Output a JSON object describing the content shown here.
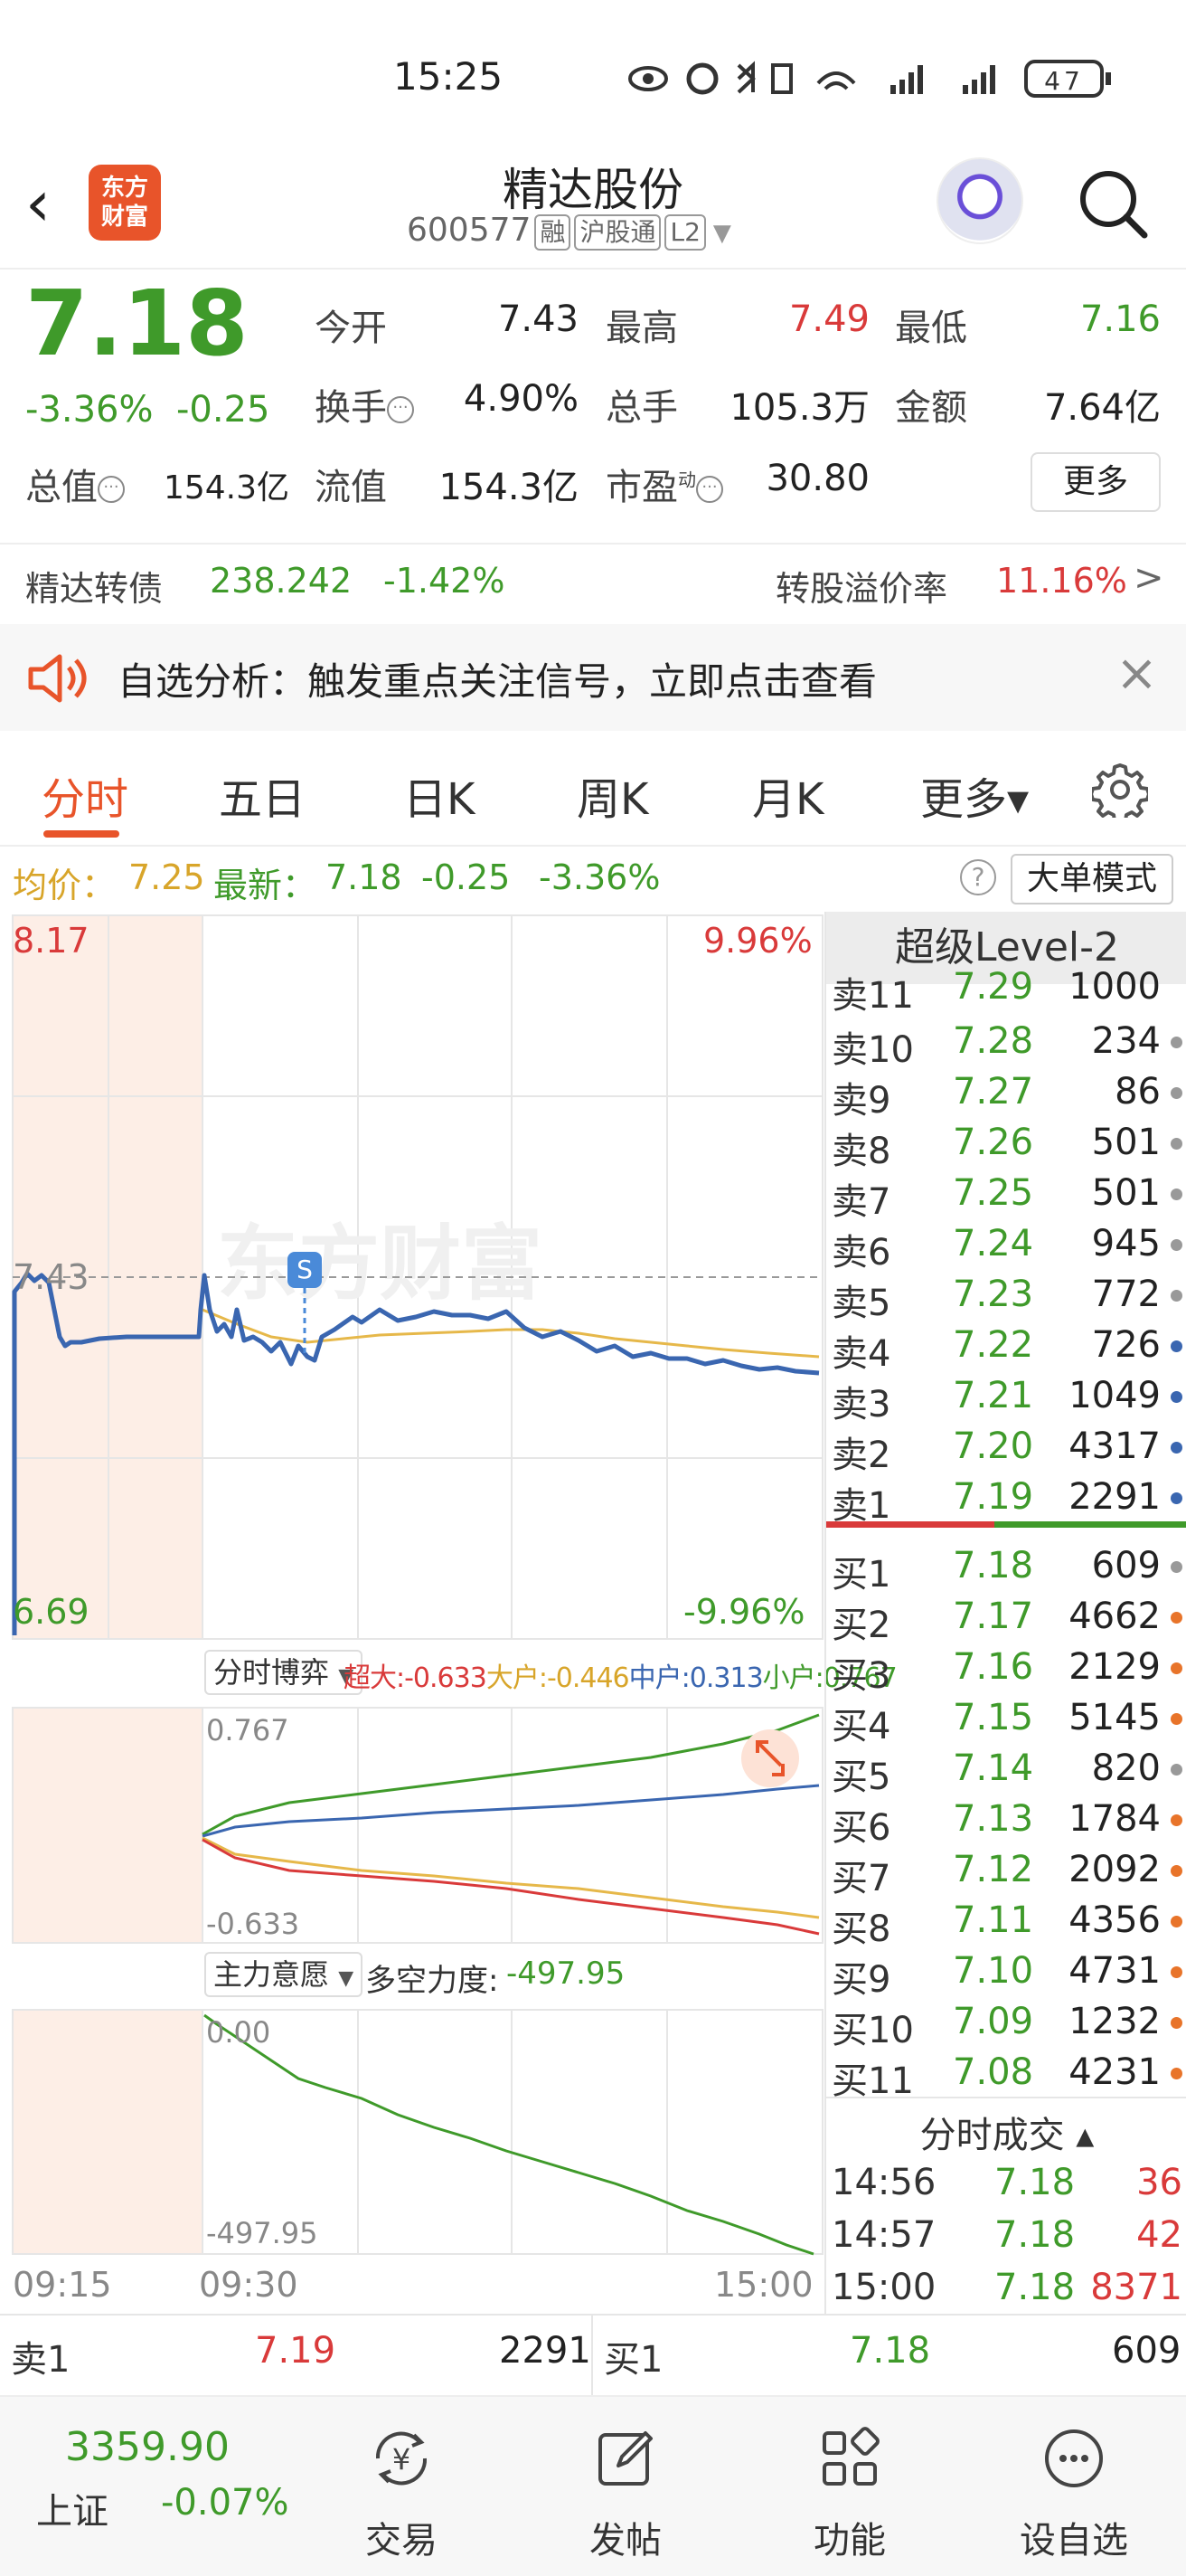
{
  "status_bar": {
    "time": "15:25",
    "battery": "47"
  },
  "header": {
    "back_glyph": "‹",
    "brand_line1": "东方",
    "brand_line2": "财富",
    "name": "精达股份",
    "code": "600577",
    "tags": [
      "融",
      "沪股通",
      "L2"
    ]
  },
  "quote": {
    "price": "7.18",
    "change_pct": "-3.36%",
    "change": "-0.25",
    "open_label": "今开",
    "open": "7.43",
    "high_label": "最高",
    "high": "7.49",
    "low_label": "最低",
    "low": "7.16",
    "turnover_rate_label": "换手",
    "turnover_rate": "4.90%",
    "volume_label": "总手",
    "volume": "105.3万",
    "amount_label": "金额",
    "amount": "7.64亿",
    "total_cap_label": "总值",
    "total_cap": "154.3亿",
    "float_cap_label": "流值",
    "float_cap": "154.3亿",
    "pe_label": "市盈",
    "pe_sup": "动",
    "pe": "30.80",
    "more_label": "更多"
  },
  "bond": {
    "name": "精达转债",
    "price": "238.242",
    "change": "-1.42%",
    "premium_label": "转股溢价率",
    "premium": "11.16%",
    "arrow": ">"
  },
  "alert": {
    "text": "自选分析：触发重点关注信号，立即点击查看",
    "close": "×"
  },
  "tabs": [
    {
      "label": "分时"
    },
    {
      "label": "五日"
    },
    {
      "label": "日K"
    },
    {
      "label": "周K"
    },
    {
      "label": "月K"
    },
    {
      "label": "更多▾"
    }
  ],
  "infobar": {
    "avg_label": "均价：",
    "avg": "7.25",
    "latest_label": "最新：",
    "latest": "7.18",
    "change": "-0.25",
    "change_pct": "-3.36%",
    "help": "?",
    "mode": "大单模式"
  },
  "chart": {
    "top_price": "8.17",
    "top_pct": "9.96%",
    "ref_price": "7.43",
    "bottom_price": "6.69",
    "bottom_pct": "-9.96%",
    "marker": "S",
    "watermark": "东方财富",
    "game_selector": "分时博弈",
    "game_legend": [
      {
        "label": "超大:",
        "value": "-0.633",
        "color": "#d93a3a"
      },
      {
        "label": "大户:",
        "value": "-0.446",
        "color": "#d8a52a"
      },
      {
        "label": "中户:",
        "value": "0.313",
        "color": "#3a66b0"
      },
      {
        "label": "小户:",
        "value": "0.767",
        "color": "#3f9a2a"
      }
    ],
    "game_max": "0.767",
    "game_min": "-0.633",
    "force_selector": "主力意愿",
    "force_label": "多空力度:",
    "force_value": "-497.95",
    "force_max": "0.00",
    "force_min": "-497.95",
    "time_start": "09:15",
    "time_open": "09:30",
    "time_end": "15:00"
  },
  "level2": {
    "title": "超级Level-2",
    "asks": [
      {
        "label": "卖11",
        "price": "7.29",
        "vol": "1000"
      },
      {
        "label": "卖10",
        "price": "7.28",
        "vol": "234",
        "dot": "gray"
      },
      {
        "label": "卖9",
        "price": "7.27",
        "vol": "86",
        "dot": "gray"
      },
      {
        "label": "卖8",
        "price": "7.26",
        "vol": "501",
        "dot": "gray"
      },
      {
        "label": "卖7",
        "price": "7.25",
        "vol": "501",
        "dot": "gray"
      },
      {
        "label": "卖6",
        "price": "7.24",
        "vol": "945",
        "dot": "gray"
      },
      {
        "label": "卖5",
        "price": "7.23",
        "vol": "772",
        "dot": "gray"
      },
      {
        "label": "卖4",
        "price": "7.22",
        "vol": "726",
        "dot": "blue"
      },
      {
        "label": "卖3",
        "price": "7.21",
        "vol": "1049",
        "dot": "blue"
      },
      {
        "label": "卖2",
        "price": "7.20",
        "vol": "4317",
        "dot": "blue"
      },
      {
        "label": "卖1",
        "price": "7.19",
        "vol": "2291",
        "dot": "blue"
      }
    ],
    "bids": [
      {
        "label": "买1",
        "price": "7.18",
        "vol": "609",
        "dot": "gray"
      },
      {
        "label": "买2",
        "price": "7.17",
        "vol": "4662",
        "dot": "orange"
      },
      {
        "label": "买3",
        "price": "7.16",
        "vol": "2129",
        "dot": "orange"
      },
      {
        "label": "买4",
        "price": "7.15",
        "vol": "5145",
        "dot": "orange"
      },
      {
        "label": "买5",
        "price": "7.14",
        "vol": "820",
        "dot": "gray"
      },
      {
        "label": "买6",
        "price": "7.13",
        "vol": "1784",
        "dot": "orange"
      },
      {
        "label": "买7",
        "price": "7.12",
        "vol": "2092",
        "dot": "orange"
      },
      {
        "label": "买8",
        "price": "7.11",
        "vol": "4356",
        "dot": "orange"
      },
      {
        "label": "买9",
        "price": "7.10",
        "vol": "4731",
        "dot": "orange"
      },
      {
        "label": "买10",
        "price": "7.09",
        "vol": "1232",
        "dot": "orange"
      },
      {
        "label": "买11",
        "price": "7.08",
        "vol": "4231",
        "dot": "orange"
      }
    ],
    "trades_title": "分时成交 ▴",
    "trades": [
      {
        "time": "14:56",
        "price": "7.18",
        "vol": "36"
      },
      {
        "time": "14:57",
        "price": "7.18",
        "vol": "42"
      },
      {
        "time": "15:00",
        "price": "7.18",
        "vol": "8371"
      }
    ]
  },
  "bottom_quote": {
    "ask_label": "卖1",
    "ask_price": "7.19",
    "ask_vol": "2291",
    "bid_label": "买1",
    "bid_price": "7.18",
    "bid_vol": "609"
  },
  "nav": {
    "index_value": "3359.90",
    "index_name": "上证",
    "index_change": "-0.07%",
    "items": [
      {
        "label": "交易"
      },
      {
        "label": "发帖"
      },
      {
        "label": "功能"
      },
      {
        "label": "设自选"
      }
    ]
  }
}
